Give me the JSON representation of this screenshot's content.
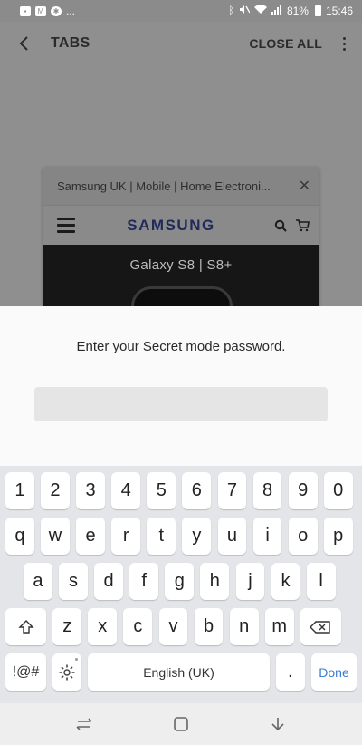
{
  "status_bar": {
    "left_icons": [
      "gallery-icon",
      "gmail-icon",
      "basketball-icon"
    ],
    "overflow": "...",
    "bluetooth": "bluetooth-icon",
    "mute": "mute-icon",
    "wifi": "wifi-icon",
    "signal": "signal-icon",
    "battery_percent": "81%",
    "time": "15:46"
  },
  "toolbar": {
    "title": "TABS",
    "close_all": "CLOSE ALL"
  },
  "tab": {
    "title": "Samsung UK | Mobile | Home Electroni...",
    "brand": "SAMSUNG",
    "hero_text": "Galaxy S8  |  S8+"
  },
  "sheet": {
    "prompt": "Enter your Secret mode password.",
    "password_value": ""
  },
  "keyboard": {
    "row_numbers": [
      "1",
      "2",
      "3",
      "4",
      "5",
      "6",
      "7",
      "8",
      "9",
      "0"
    ],
    "row_top": [
      "q",
      "w",
      "e",
      "r",
      "t",
      "y",
      "u",
      "i",
      "o",
      "p"
    ],
    "row_middle": [
      "a",
      "s",
      "d",
      "f",
      "g",
      "h",
      "j",
      "k",
      "l"
    ],
    "row_bottom": [
      "z",
      "x",
      "c",
      "v",
      "b",
      "n",
      "m"
    ],
    "symbols_label": "!@#",
    "space_label": "English (UK)",
    "period_label": ".",
    "done_label": "Done",
    "done_color": "#3d7bd0"
  },
  "navbar": {
    "icons": [
      "recents-icon",
      "home-icon",
      "back-icon"
    ]
  }
}
